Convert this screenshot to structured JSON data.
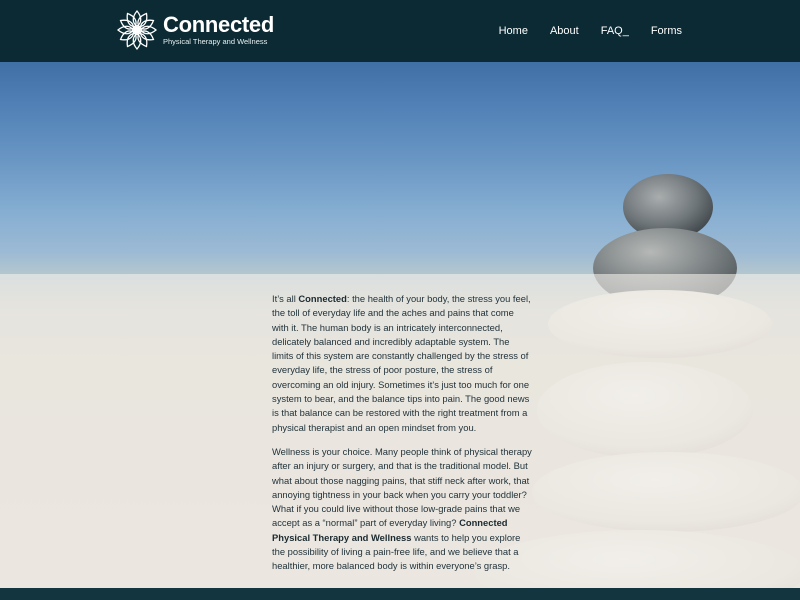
{
  "brand": {
    "name": "Connected",
    "tagline": "Physical Therapy and Wellness"
  },
  "nav": {
    "items": [
      {
        "label": "Home"
      },
      {
        "label": "About"
      },
      {
        "label": "FAQ_"
      },
      {
        "label": "Forms"
      }
    ]
  },
  "content": {
    "p1": {
      "before": "It’s all ",
      "highlight": "Connected",
      "after": ": the health of your body, the stress you feel, the toll of everyday life and the aches and pains that come with it. The human body is an intricately interconnected, delicately balanced and incredibly adaptable system. The limits of this system are constantly challenged by the stress of everyday life, the stress of poor posture, the stress of overcoming an old injury. Sometimes it’s just too much for one system to bear, and the balance tips into pain. The good news is that balance can be restored with the right treatment from a physical therapist and an open mindset from you."
    },
    "p2": {
      "before": "Wellness is your choice. Many people think of physical therapy after an injury or surgery, and that is the traditional model. But what about those nagging pains, that stiff neck after work, that annoying tightness in your back when you carry your toddler? What if you could live without those low-grade pains that we accept as a “normal” part of everyday living? ",
      "highlight": "Connected Physical Therapy and Wellness",
      "after": " wants to help you explore the possibility of living a pain-free life, and we believe that a healthier, more balanced body is within everyone’s grasp."
    }
  },
  "colors": {
    "header_bg": "#0c2a33",
    "sky_top": "#3f6fa5",
    "sand": "#e3ddd2",
    "text": "#22333b"
  }
}
